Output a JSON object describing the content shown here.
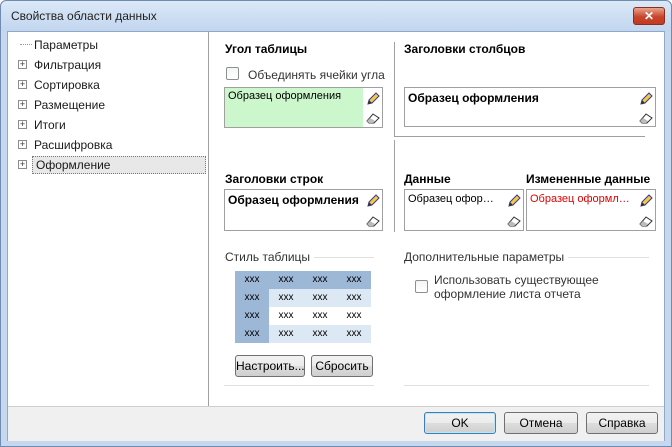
{
  "window": {
    "title": "Свойства области данных",
    "close_label": "✕"
  },
  "tree": {
    "items": [
      {
        "label": "Параметры",
        "expandable": false,
        "selected": false
      },
      {
        "label": "Фильтрация",
        "expandable": true,
        "selected": false
      },
      {
        "label": "Сортировка",
        "expandable": true,
        "selected": false
      },
      {
        "label": "Размещение",
        "expandable": true,
        "selected": false
      },
      {
        "label": "Итоги",
        "expandable": true,
        "selected": false
      },
      {
        "label": "Расшифровка",
        "expandable": true,
        "selected": false
      },
      {
        "label": "Оформление",
        "expandable": true,
        "selected": true
      }
    ],
    "expander_symbol": "+"
  },
  "corner": {
    "title": "Угол таблицы",
    "merge_label": "Объединять ячейки угла",
    "sample_text": "Образец оформления",
    "sample_bg": "#ccf7cc"
  },
  "col_headers": {
    "title": "Заголовки столбцов",
    "sample_text": "Образец оформления"
  },
  "row_headers": {
    "title": "Заголовки строк",
    "sample_text": "Образец оформления"
  },
  "data_sec": {
    "title": "Данные",
    "sample_text": "Образец оформления"
  },
  "changed_data": {
    "title": "Измененные данные",
    "sample_text": "Образец оформления",
    "text_color": "#e00000"
  },
  "table_style": {
    "title": "Стиль таблицы",
    "cells": [
      "xxx",
      "xxx",
      "xxx",
      "xxx",
      "xxx",
      "xxx",
      "xxx",
      "xxx",
      "xxx",
      "xxx",
      "xxx",
      "xxx",
      "xxx",
      "xxx",
      "xxx",
      "xxx"
    ],
    "setup_label": "Настроить...",
    "reset_label": "Сбросить"
  },
  "extra": {
    "title": "Дополнительные параметры",
    "use_existing_line1": "Использовать существующее",
    "use_existing_line2": "оформление листа отчета"
  },
  "footer": {
    "ok_label": "OK",
    "cancel_label": "Отмена",
    "help_label": "Справка"
  },
  "colors": {
    "header_cell": "#9db7d7",
    "band_cell": "#dce8f4",
    "plain_cell": "#ffffff"
  }
}
